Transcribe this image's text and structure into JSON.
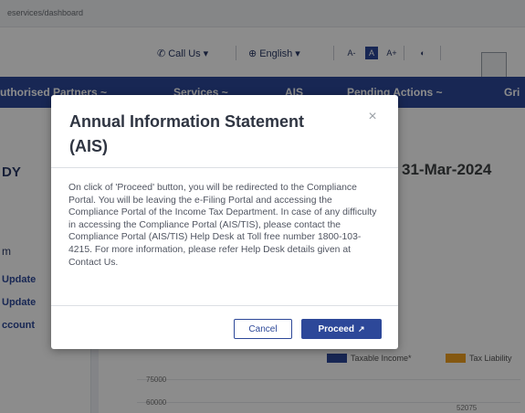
{
  "browser": {
    "url": "eservices/dashboard"
  },
  "utility": {
    "call_us": "Call Us",
    "language": "English",
    "font_small": "A-",
    "font_normal": "A",
    "font_large": "A+",
    "contrast": "◐"
  },
  "nav": {
    "items": [
      {
        "label": "uthorised Partners ~"
      },
      {
        "label": "Services ~"
      },
      {
        "label": "AIS"
      },
      {
        "label": "Pending Actions ~"
      },
      {
        "label": "Gri"
      }
    ]
  },
  "background": {
    "left_title": "DY",
    "date": "31-Mar-2024",
    "left_label": "m",
    "links": [
      "Update",
      "Update",
      "ccount"
    ],
    "legend": [
      {
        "label": "Taxable Income*",
        "color": "#2d4899"
      },
      {
        "label": "Tax Liability",
        "color": "#f0a020"
      }
    ],
    "axis_values": [
      "75000",
      "60000",
      "52075"
    ]
  },
  "modal": {
    "title": "Annual Information Statement (AIS)",
    "close_glyph": "×",
    "body": "On click of 'Proceed' button, you will be redirected to the Compliance Portal. You will be leaving the e-Filing Portal and accessing the Compliance Portal of the Income Tax Department. In case of any difficulty in accessing the Compliance Portal (AIS/TIS), please contact the Compliance Portal (AIS/TIS) Help Desk at Toll free number 1800-103-4215. For more information, please refer Help Desk details given at Contact Us.",
    "cancel_label": "Cancel",
    "proceed_label": "Proceed",
    "proceed_icon": "↗"
  }
}
